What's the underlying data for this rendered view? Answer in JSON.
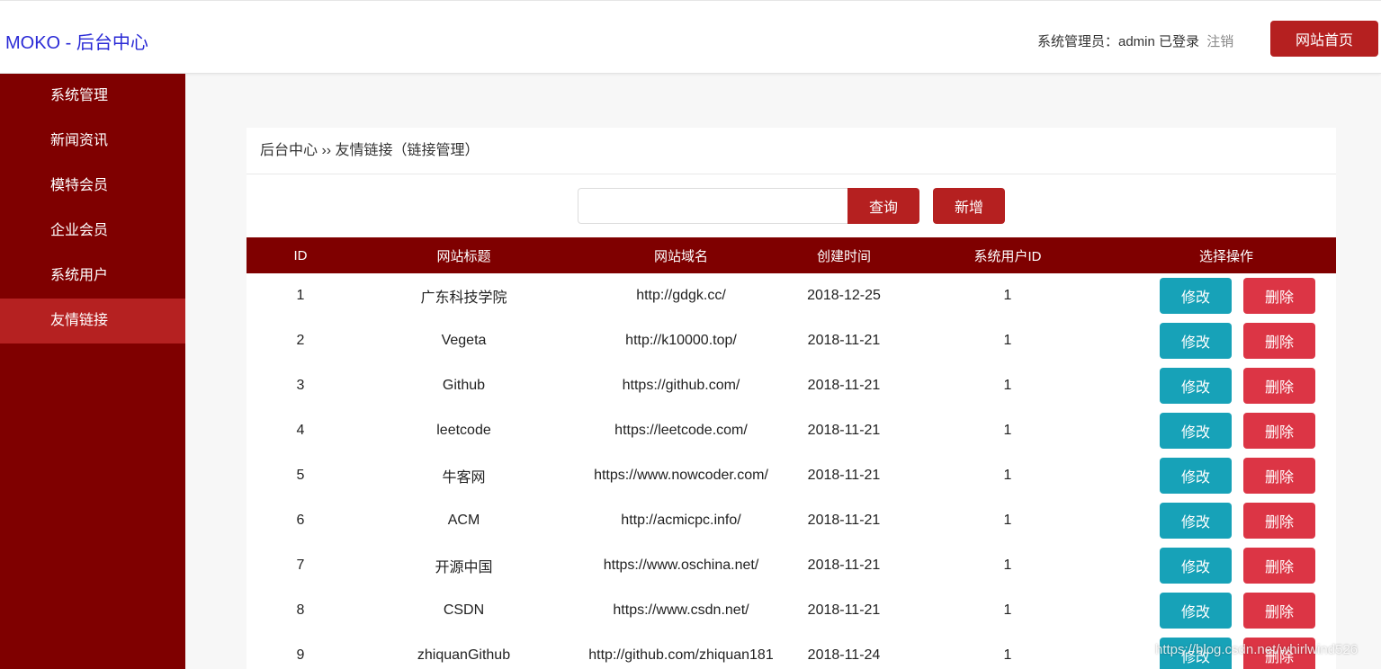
{
  "header": {
    "brand": "MOKO - 后台中心",
    "user_text": "系统管理员：admin 已登录",
    "logout_label": "注销",
    "home_button": "网站首页"
  },
  "sidebar": {
    "items": [
      {
        "label": "系统管理"
      },
      {
        "label": "新闻资讯"
      },
      {
        "label": "模特会员"
      },
      {
        "label": "企业会员"
      },
      {
        "label": "系统用户"
      },
      {
        "label": "友情链接",
        "active": true
      }
    ]
  },
  "breadcrumb": "后台中心 ›› 友情链接（链接管理）",
  "search": {
    "value": "",
    "search_button": "查询",
    "add_button": "新增"
  },
  "table": {
    "columns": [
      "ID",
      "网站标题",
      "网站域名",
      "创建时间",
      "系统用户ID",
      "选择操作"
    ],
    "edit_label": "修改",
    "delete_label": "删除",
    "rows": [
      {
        "id": "1",
        "title": "广东科技学院",
        "domain": "http://gdgk.cc/",
        "created": "2018-12-25",
        "user_id": "1"
      },
      {
        "id": "2",
        "title": "Vegeta",
        "domain": "http://k10000.top/",
        "created": "2018-11-21",
        "user_id": "1"
      },
      {
        "id": "3",
        "title": "Github",
        "domain": "https://github.com/",
        "created": "2018-11-21",
        "user_id": "1"
      },
      {
        "id": "4",
        "title": "leetcode",
        "domain": "https://leetcode.com/",
        "created": "2018-11-21",
        "user_id": "1"
      },
      {
        "id": "5",
        "title": "牛客网",
        "domain": "https://www.nowcoder.com/",
        "created": "2018-11-21",
        "user_id": "1"
      },
      {
        "id": "6",
        "title": "ACM",
        "domain": "http://acmicpc.info/",
        "created": "2018-11-21",
        "user_id": "1"
      },
      {
        "id": "7",
        "title": "开源中国",
        "domain": "https://www.oschina.net/",
        "created": "2018-11-21",
        "user_id": "1"
      },
      {
        "id": "8",
        "title": "CSDN",
        "domain": "https://www.csdn.net/",
        "created": "2018-11-21",
        "user_id": "1"
      },
      {
        "id": "9",
        "title": "zhiquanGithub",
        "domain": "http://github.com/zhiquan181",
        "created": "2018-11-24",
        "user_id": "1"
      }
    ]
  },
  "watermark": "https://blog.csdn.net/whirlwind526",
  "colors": {
    "primary_dark_red": "#7f0000",
    "accent_red": "#b52020",
    "edit_teal": "#17a2b8",
    "delete_red": "#dc3545",
    "brand_blue": "#2a2ad6"
  }
}
